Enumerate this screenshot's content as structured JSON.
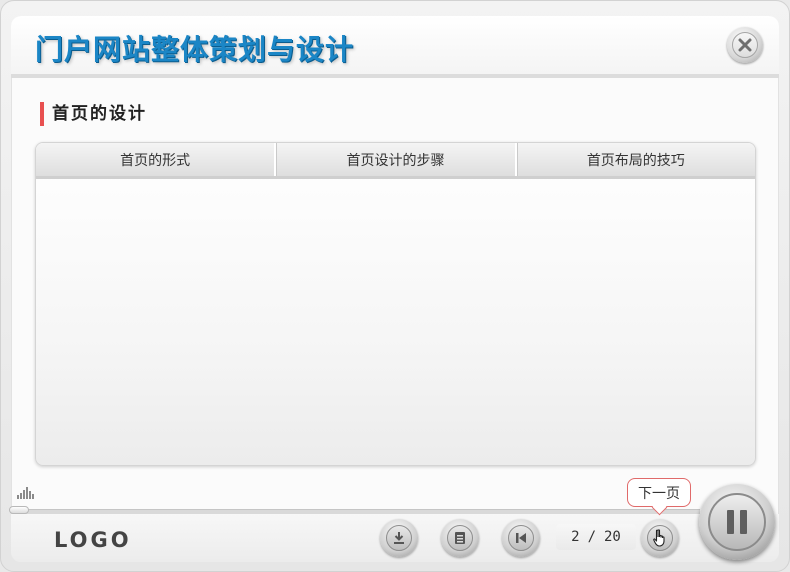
{
  "header": {
    "title": "门户网站整体策划与设计"
  },
  "section": {
    "title": "首页的设计"
  },
  "tabs": [
    {
      "label": "首页的形式"
    },
    {
      "label": "首页设计的步骤"
    },
    {
      "label": "首页布局的技巧"
    }
  ],
  "footer": {
    "logo": "LOGO",
    "page_current": "2",
    "page_separator": "/",
    "page_total": "20",
    "tooltip": "下一页"
  },
  "colors": {
    "title_blue": "#1b86c6",
    "section_accent": "#e85050",
    "tooltip_border": "#e06a6a"
  },
  "icons": {
    "close": "close-icon",
    "volume": "volume-icon",
    "download": "download-icon",
    "menu": "list-icon",
    "previous": "previous-icon",
    "next": "hand-pointer-icon",
    "pause": "pause-icon"
  }
}
